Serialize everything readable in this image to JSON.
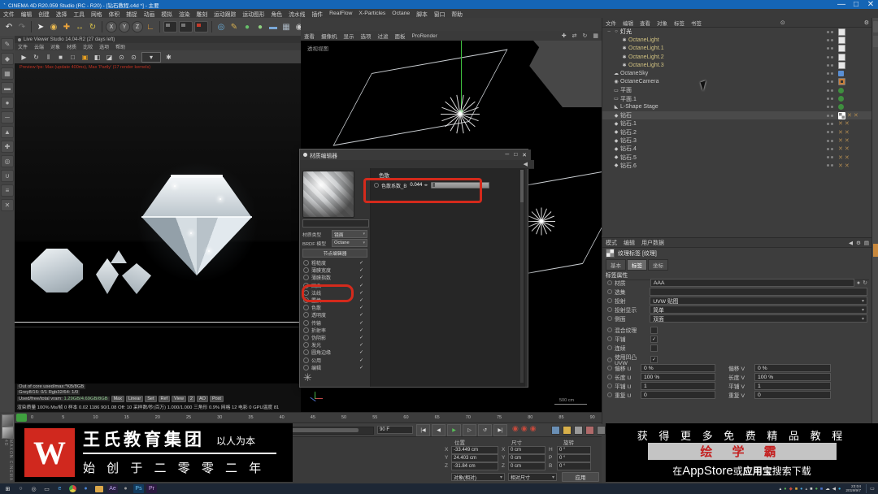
{
  "window": {
    "title": "CINEMA 4D R20.059 Studio (RC - R20) - [钻石教程.c4d *] - 主要",
    "controls": [
      "—",
      "□",
      "✕"
    ]
  },
  "menubar": [
    "文件",
    "编辑",
    "创建",
    "选择",
    "工具",
    "网格",
    "体积",
    "捕捉",
    "动画",
    "模拟",
    "渲染",
    "雕刻",
    "运动跟踪",
    "运动图形",
    "角色",
    "流水线",
    "插件",
    "RealFlow",
    "X-Particles",
    "Octane",
    "脚本",
    "窗口",
    "帮助"
  ],
  "toolbar": [
    {
      "n": "undo-icon",
      "g": "↶",
      "c": "#e8e8e8"
    },
    {
      "n": "redo-icon",
      "g": "↷",
      "c": "#7a7a7a"
    },
    {
      "n": "sep"
    },
    {
      "n": "cursor-tool-icon",
      "g": "➤",
      "c": "#f0f0f0"
    },
    {
      "n": "live-selection-icon",
      "g": "◉",
      "c": "#e8b850"
    },
    {
      "n": "move-tool-icon",
      "g": "✚",
      "c": "#e8a23c"
    },
    {
      "n": "scale-tool-icon",
      "g": "↔",
      "c": "#d8c24a"
    },
    {
      "n": "rotate-tool-icon",
      "g": "↻",
      "c": "#d8c24a"
    },
    {
      "n": "sep"
    },
    {
      "n": "x-axis-toggle",
      "g": "X",
      "circ": 1
    },
    {
      "n": "y-axis-toggle",
      "g": "Y",
      "circ": 1
    },
    {
      "n": "z-axis-toggle",
      "g": "Z",
      "circ": 1
    },
    {
      "n": "coord-system-icon",
      "g": "∟",
      "c": "#e8a23c"
    },
    {
      "n": "sep"
    },
    {
      "n": "render-view-icon",
      "clap": 1
    },
    {
      "n": "render-region-icon",
      "clap": 1
    },
    {
      "n": "render-settings-icon",
      "clap": 1,
      "red": 1
    },
    {
      "n": "sep"
    },
    {
      "n": "octane-globe-icon",
      "g": "◎",
      "c": "#6ab0e0"
    },
    {
      "n": "octane-pen-icon",
      "g": "✎",
      "c": "#d8b050"
    },
    {
      "n": "octane-ball-icon",
      "g": "●",
      "c": "#66c06a"
    },
    {
      "n": "octane-ball2-icon",
      "g": "●",
      "c": "#8fd080"
    },
    {
      "n": "octane-capsule-icon",
      "g": "▬",
      "c": "#7aa8d8"
    },
    {
      "n": "octane-grid-icon",
      "g": "▦",
      "c": "#a8b4c0"
    },
    {
      "n": "octane-camera-icon",
      "g": "◉",
      "c": "#c8c8c8"
    },
    {
      "n": "octane-light-icon",
      "g": "☀",
      "c": "#e8e8e8"
    }
  ],
  "left_toolbar": [
    {
      "n": "make-editable-icon",
      "g": "✎"
    },
    {
      "n": "model-mode-icon",
      "g": "◆"
    },
    {
      "n": "texture-mode-icon",
      "g": "▦"
    },
    {
      "n": "workplane-icon",
      "g": "▬"
    },
    {
      "n": "points-mode-icon",
      "g": "●"
    },
    {
      "n": "edges-mode-icon",
      "g": "─"
    },
    {
      "n": "polygons-mode-icon",
      "g": "▲"
    },
    {
      "n": "axis-mode-icon",
      "g": "✚"
    },
    {
      "n": "solo-mode-icon",
      "g": "◎"
    },
    {
      "n": "snap-icon",
      "g": "∪"
    },
    {
      "n": "workplane-lock-icon",
      "g": "≡"
    },
    {
      "n": "quantize-icon",
      "g": "✕"
    }
  ],
  "live_viewer": {
    "title": "Live Viewer Studio 14.04-R2 (27 days left)",
    "menus": [
      "文件",
      "云端",
      "对象",
      "材质",
      "比较",
      "选项",
      "帮助"
    ],
    "tools": [
      {
        "n": "lv-play-icon",
        "g": "▶"
      },
      {
        "n": "lv-restart-icon",
        "g": "↻"
      },
      {
        "n": "lv-pause-icon",
        "g": "‖"
      },
      {
        "n": "lv-stop-icon",
        "g": "■"
      },
      {
        "n": "lv-region-icon",
        "g": "□"
      },
      {
        "n": "lv-lock-icon",
        "g": "▣",
        "c": "#e8a020"
      },
      {
        "n": "lv-layer-icon",
        "g": "◧"
      },
      {
        "n": "lv-pick-material-icon",
        "g": "◪"
      },
      {
        "n": "lv-focus-pin-icon",
        "g": "⊙"
      },
      {
        "n": "lv-camera-pin-icon",
        "g": "⊙"
      },
      {
        "n": "lv-resolution-dropdown",
        "g": "▾",
        "box": 1
      },
      {
        "n": "lv-settings-icon",
        "g": "✱"
      }
    ],
    "overlay": "Preview fps: Max (update 400ms), Max 'Partly' (17 render kernels)",
    "stats1": "Out of core used/max:*KB/8GB",
    "stats2": "Grey8/16: 0/1      Rgb32/64: 1/0",
    "vram_label": "Used/free/total vram:",
    "vram_value": "1.29GB/4.69GB/8GB",
    "stat_buttons": [
      "Max",
      "Linear",
      "Set",
      "Ref",
      "View",
      "2",
      "AO",
      "Post"
    ],
    "status": "渲染质量 100%   Ms/帧 0   样本 0.02  1186   90/1.08   Off: 10   采样数/秒(百万) 1.000/1.000   三角形 0.9%   网格 12   电影 0   GPU温度 81"
  },
  "viewport": {
    "label": "透视视图",
    "menus": [
      "查看",
      "摄像机",
      "显示",
      "选项",
      "过滤",
      "面板",
      "ProRender"
    ],
    "nav": [
      "✚",
      "⇄",
      "↻",
      "▦"
    ],
    "scale": "500 cm"
  },
  "material_editor": {
    "title": "材质编辑器",
    "dialog_buttons": [
      "─",
      "□",
      "✕"
    ],
    "nav_back": "◀",
    "name_label": "名称",
    "name_value": "",
    "type_label": "材质类型",
    "type_value": "镜面",
    "brdf_label": "BRDF 模型",
    "brdf_value": "Octane",
    "node_button": "节点编辑器",
    "channels": [
      {
        "label": "粗糙度"
      },
      {
        "label": "薄膜宽度"
      },
      {
        "label": "薄膜指数"
      },
      {
        "label": "凹凸"
      },
      {
        "label": "法线"
      },
      {
        "label": "置换"
      },
      {
        "label": "色散",
        "highlight": true
      },
      {
        "label": "透明度"
      },
      {
        "label": "传输"
      },
      {
        "label": "折射率"
      },
      {
        "label": "伪阴影"
      },
      {
        "label": "发光"
      },
      {
        "label": "圆角边缘"
      },
      {
        "label": "公用"
      },
      {
        "label": "编辑"
      }
    ],
    "section": "色散",
    "param_label": "色散系数_B",
    "param_value": "0.044"
  },
  "object_manager": {
    "menus": [
      "文件",
      "编辑",
      "查看",
      "对象",
      "标签",
      "书签"
    ],
    "right_icons": [
      "⊙",
      "⚙"
    ],
    "items": [
      {
        "name": "灯光",
        "indent": 0,
        "icon": "null",
        "expand": "−",
        "color": "#ffffff",
        "tags": [
          "sq"
        ]
      },
      {
        "name": "OctaneLight",
        "indent": 1,
        "icon": "light",
        "color": "#cfc080",
        "tags": [
          "sq"
        ]
      },
      {
        "name": "OctaneLight.1",
        "indent": 1,
        "icon": "light",
        "color": "#cfc080",
        "tags": [
          "sq"
        ]
      },
      {
        "name": "OctaneLight.2",
        "indent": 1,
        "icon": "light",
        "color": "#cfc080",
        "tags": [
          "sq"
        ]
      },
      {
        "name": "OctaneLight.3",
        "indent": 1,
        "icon": "light",
        "color": "#cfc080",
        "tags": [
          "sq"
        ]
      },
      {
        "name": "OctaneSky",
        "indent": 0,
        "icon": "sky",
        "tags": [
          "sky"
        ]
      },
      {
        "name": "OctaneCamera",
        "indent": 0,
        "icon": "camera",
        "tags": [
          "cam"
        ]
      },
      {
        "name": "平面",
        "indent": 0,
        "icon": "plane",
        "tags": [
          "chk"
        ]
      },
      {
        "name": "平面.1",
        "indent": 0,
        "icon": "plane",
        "tags": [
          "chk"
        ]
      },
      {
        "name": "L-Shape Stage",
        "indent": 0,
        "icon": "stage",
        "tags": [
          "chk"
        ]
      },
      {
        "name": "钻石",
        "indent": 0,
        "icon": "gem",
        "selected": true,
        "tags": [
          "tex",
          "x",
          "x"
        ]
      },
      {
        "name": "钻石.1",
        "indent": 0,
        "icon": "gem",
        "tags": [
          "x",
          "x"
        ]
      },
      {
        "name": "钻石.2",
        "indent": 0,
        "icon": "gem",
        "tags": [
          "x",
          "x"
        ]
      },
      {
        "name": "钻石.3",
        "indent": 0,
        "icon": "gem",
        "tags": [
          "x",
          "x"
        ]
      },
      {
        "name": "钻石.4",
        "indent": 0,
        "icon": "gem",
        "tags": [
          "x",
          "x"
        ]
      },
      {
        "name": "钻石.5",
        "indent": 0,
        "icon": "gem",
        "tags": [
          "x",
          "x"
        ]
      },
      {
        "name": "钻石.6",
        "indent": 0,
        "icon": "gem",
        "tags": [
          "x",
          "x"
        ]
      }
    ]
  },
  "attributes": {
    "menus": [
      "模式",
      "编辑",
      "用户数据"
    ],
    "right_icons": [
      "◀",
      "⚙",
      "▤"
    ],
    "title": "纹理标签 [纹理]",
    "tabs": [
      "基本",
      "标签",
      "坐标"
    ],
    "active_tab": "标签",
    "section": "标签属性",
    "material_label": "材质",
    "material_value": "AAA",
    "selection_label": "选集",
    "selection_value": "",
    "projection_label": "投射",
    "projection_value": "UVW 贴图",
    "display_label": "投射显示",
    "display_value": "简单",
    "side_label": "侧面",
    "side_value": "双面",
    "mix_label": "混合纹理",
    "mix_checked": false,
    "tile_label": "平铺",
    "tile_checked": true,
    "seamless_label": "连续",
    "seamless_checked": false,
    "bumpuvw_label": "使用凹凸 UVW",
    "bumpuvw_checked": true,
    "uv_fields": [
      {
        "l1": "偏移 U",
        "v1": "0 %",
        "l2": "偏移 V",
        "v2": "0 %"
      },
      {
        "l1": "长度 U",
        "v1": "100 %",
        "l2": "长度 V",
        "v2": "100 %"
      },
      {
        "l1": "平铺 U",
        "v1": "1",
        "l2": "平铺 V",
        "v2": "1"
      },
      {
        "l1": "重复 U",
        "v1": "0",
        "l2": "重复 V",
        "v2": "0"
      }
    ]
  },
  "coordinates": {
    "pos_header": "位置",
    "size_header": "尺寸",
    "rot_header": "旋转",
    "rows": [
      {
        "pl": "X",
        "pv": "-33.449 cm",
        "sl": "X",
        "sv": "0 cm",
        "rl": "H",
        "rv": "0 °"
      },
      {
        "pl": "Y",
        "pv": "24.403 cm",
        "sl": "Y",
        "sv": "0 cm",
        "rl": "P",
        "rv": "0 °"
      },
      {
        "pl": "Z",
        "pv": "-31.84 cm",
        "sl": "Z",
        "sv": "0 cm",
        "rl": "B",
        "rv": "0 °"
      }
    ],
    "mode1": "对象(相对)",
    "mode2": "相对尺寸",
    "apply": "应用"
  },
  "timeline": {
    "ticks": [
      "0",
      "5",
      "10",
      "15",
      "20",
      "25",
      "30",
      "35",
      "40",
      "45",
      "50",
      "55",
      "60",
      "65",
      "70",
      "75",
      "80",
      "85",
      "90"
    ],
    "frame": "90 F"
  },
  "transport": {
    "buttons": [
      {
        "n": "goto-start-button",
        "g": "|◀"
      },
      {
        "n": "prev-key-button",
        "g": "◀"
      },
      {
        "n": "play-button",
        "g": "▶",
        "c": "#58c058"
      },
      {
        "n": "next-frame-button",
        "g": "▷"
      },
      {
        "n": "loop-button",
        "g": "↺"
      },
      {
        "n": "goto-end-button",
        "g": "▶|"
      }
    ],
    "records": [
      {
        "n": "record-keyframe-button"
      },
      {
        "n": "autokey-button"
      },
      {
        "n": "keyframe-selection-button"
      }
    ],
    "toggles": [
      "#6a8fb5",
      "#d8b04a",
      "#9a9a9a",
      "#b06a6a",
      "#777777"
    ]
  },
  "branding_left": {
    "company": "王氏教育集团",
    "slogan": "以人为本",
    "line2": "始 创 于 二 零 零 二 年",
    "logo_letter": "W"
  },
  "branding_right": {
    "line1": "获 得 更 多 免 费 精 品 教 程",
    "app": "绘 学 霸",
    "l3_pre": "在",
    "l3_store": "AppStore",
    "l3_mid": "或",
    "l3_yyb": "应用宝",
    "l3_post": "搜索下载"
  },
  "edge": {
    "maxon": "MAXON CINEMA 4D"
  },
  "taskbar": {
    "apps": [
      {
        "n": "start-button",
        "g": "⊞",
        "c": "#e8e8e8"
      },
      {
        "n": "search-icon",
        "g": "○",
        "c": "#cfcfcf"
      },
      {
        "n": "cortana-icon",
        "g": "◎",
        "c": "#cfcfcf"
      },
      {
        "n": "task-view-icon",
        "g": "▭",
        "c": "#cfcfcf"
      },
      {
        "n": "edge-icon",
        "g": "e",
        "c": "#4aa3e8"
      },
      {
        "n": "chrome-icon",
        "chrome": 1
      },
      {
        "n": "app-icon-blue",
        "g": "●",
        "c": "#4a86d8"
      },
      {
        "n": "folder-icon",
        "folder": 1
      },
      {
        "n": "after-effects-icon",
        "g": "Ae",
        "bg": "#27203f",
        "c": "#b8a0e8"
      },
      {
        "n": "app-icon-gray",
        "g": "●",
        "c": "#9a9a9a"
      },
      {
        "n": "photoshop-icon",
        "g": "Ps",
        "bg": "#123a5e",
        "c": "#6ac0f0"
      },
      {
        "n": "premiere-icon",
        "g": "Pr",
        "bg": "#2a1a40",
        "c": "#c8a0e0"
      }
    ],
    "tray": [
      {
        "g": "▴",
        "c": "#cfcfcf"
      },
      {
        "g": "●",
        "c": "#58b058"
      },
      {
        "g": "◆",
        "c": "#c44a3c"
      },
      {
        "g": "■",
        "c": "#d8a83c"
      },
      {
        "g": "●",
        "c": "#4aa0d8"
      },
      {
        "g": "▴",
        "c": "#9a9a9a"
      },
      {
        "g": "■",
        "c": "#cfcfcf"
      },
      {
        "g": "●",
        "c": "#58b058"
      },
      {
        "g": "■",
        "c": "#4a72c8"
      },
      {
        "g": "☁",
        "c": "#cfcfcf"
      },
      {
        "g": "◀",
        "c": "#cfcfcf"
      },
      {
        "g": "●",
        "c": "#38b0e0"
      }
    ],
    "time": "23:04",
    "date": "2019/9/7"
  }
}
